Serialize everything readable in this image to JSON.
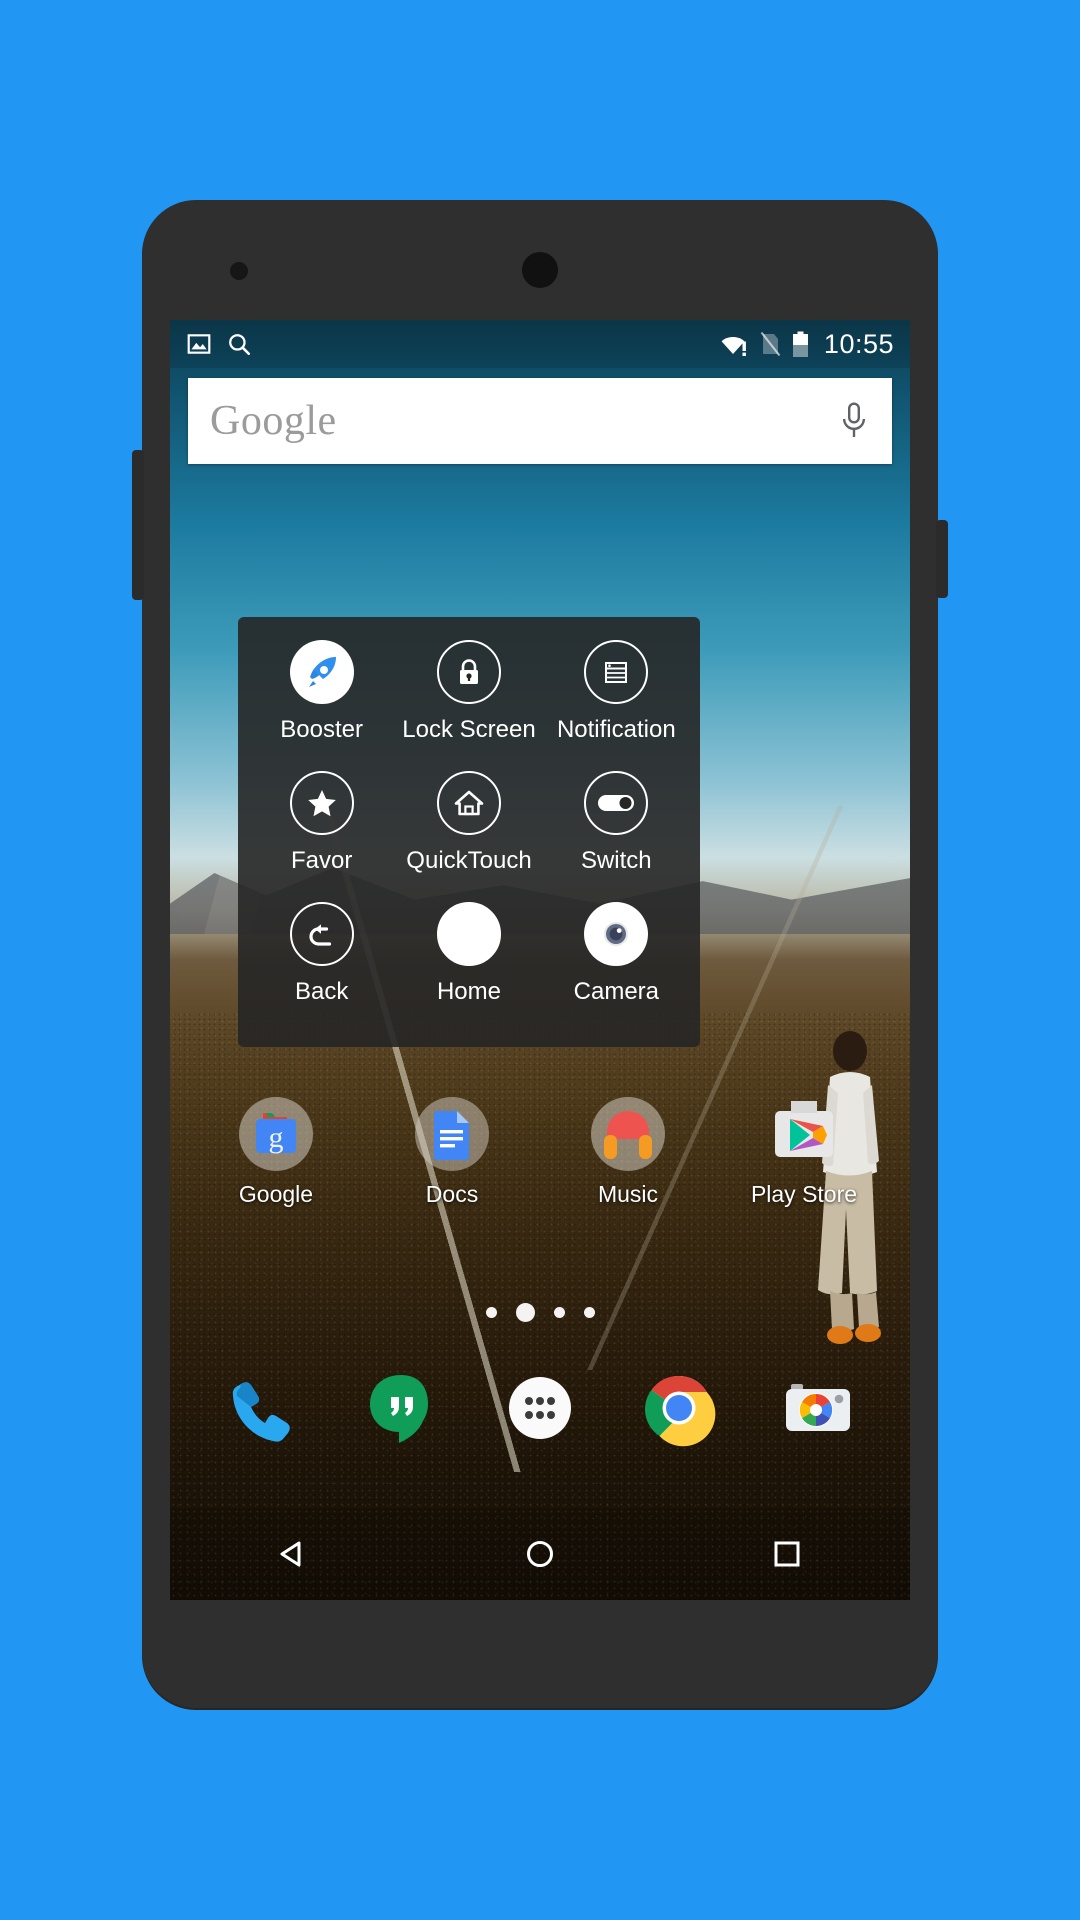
{
  "device": {
    "frame_color": "#2f2f2f",
    "background_color": "#2196f3"
  },
  "status_bar": {
    "left_icons": [
      "image-icon",
      "search-icon"
    ],
    "right_icons": [
      "wifi-warning-icon",
      "signal-off-icon",
      "battery-icon"
    ],
    "clock": "10:55"
  },
  "search": {
    "logo_text": "Google",
    "placeholder": "Google",
    "mic_icon": "microphone-icon"
  },
  "popup": {
    "items": [
      {
        "label": "Booster",
        "icon": "rocket-icon",
        "style": "filled-white"
      },
      {
        "label": "Lock Screen",
        "icon": "lock-icon",
        "style": "ring"
      },
      {
        "label": "Notification",
        "icon": "notification-list-icon",
        "style": "ring"
      },
      {
        "label": "Favor",
        "icon": "star-icon",
        "style": "ring"
      },
      {
        "label": "QuickTouch",
        "icon": "home-icon",
        "style": "ring"
      },
      {
        "label": "Switch",
        "icon": "toggle-on-icon",
        "style": "ring"
      },
      {
        "label": "Back",
        "icon": "back-arrow-icon",
        "style": "ring"
      },
      {
        "label": "Home",
        "icon": "home-circle-icon",
        "style": "solid"
      },
      {
        "label": "Camera",
        "icon": "camera-lens-icon",
        "style": "filled-white"
      }
    ]
  },
  "apps": [
    {
      "label": "Google",
      "icon": "google-folder-icon"
    },
    {
      "label": "Docs",
      "icon": "google-docs-icon"
    },
    {
      "label": "Music",
      "icon": "play-music-icon"
    },
    {
      "label": "Play Store",
      "icon": "play-store-icon"
    }
  ],
  "pager": {
    "count": 4,
    "active_index": 1
  },
  "dock": [
    {
      "label": "Phone",
      "icon": "phone-icon"
    },
    {
      "label": "Hangouts",
      "icon": "hangouts-icon"
    },
    {
      "label": "App Drawer",
      "icon": "app-drawer-icon"
    },
    {
      "label": "Chrome",
      "icon": "chrome-icon"
    },
    {
      "label": "Camera",
      "icon": "google-camera-icon"
    }
  ],
  "nav_bar": [
    {
      "label": "Back",
      "icon": "nav-back-triangle-icon"
    },
    {
      "label": "Home",
      "icon": "nav-home-circle-icon"
    },
    {
      "label": "Recents",
      "icon": "nav-recents-square-icon"
    }
  ],
  "colors": {
    "accent_blue": "#2196f3",
    "panel": "rgba(38,38,38,0.90)",
    "text": "#ffffff"
  }
}
